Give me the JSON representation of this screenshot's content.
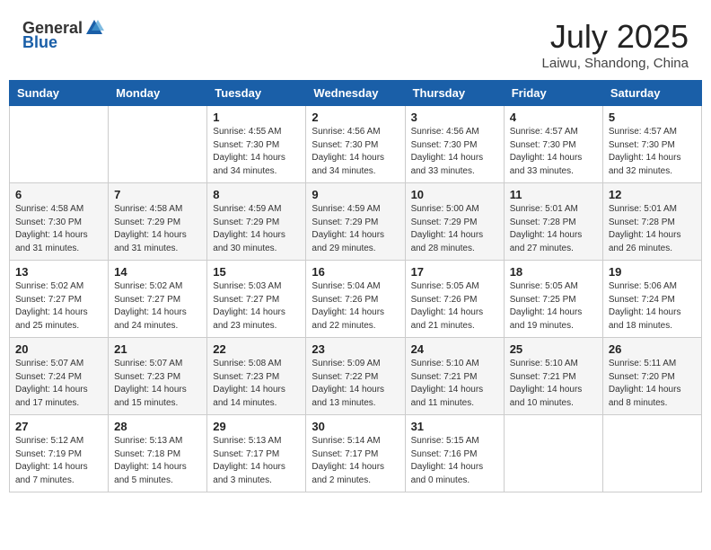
{
  "logo": {
    "general": "General",
    "blue": "Blue"
  },
  "title": "July 2025",
  "subtitle": "Laiwu, Shandong, China",
  "weekdays": [
    "Sunday",
    "Monday",
    "Tuesday",
    "Wednesday",
    "Thursday",
    "Friday",
    "Saturday"
  ],
  "weeks": [
    [
      {
        "day": "",
        "sunrise": "",
        "sunset": "",
        "daylight": ""
      },
      {
        "day": "",
        "sunrise": "",
        "sunset": "",
        "daylight": ""
      },
      {
        "day": "1",
        "sunrise": "Sunrise: 4:55 AM",
        "sunset": "Sunset: 7:30 PM",
        "daylight": "Daylight: 14 hours and 34 minutes."
      },
      {
        "day": "2",
        "sunrise": "Sunrise: 4:56 AM",
        "sunset": "Sunset: 7:30 PM",
        "daylight": "Daylight: 14 hours and 34 minutes."
      },
      {
        "day": "3",
        "sunrise": "Sunrise: 4:56 AM",
        "sunset": "Sunset: 7:30 PM",
        "daylight": "Daylight: 14 hours and 33 minutes."
      },
      {
        "day": "4",
        "sunrise": "Sunrise: 4:57 AM",
        "sunset": "Sunset: 7:30 PM",
        "daylight": "Daylight: 14 hours and 33 minutes."
      },
      {
        "day": "5",
        "sunrise": "Sunrise: 4:57 AM",
        "sunset": "Sunset: 7:30 PM",
        "daylight": "Daylight: 14 hours and 32 minutes."
      }
    ],
    [
      {
        "day": "6",
        "sunrise": "Sunrise: 4:58 AM",
        "sunset": "Sunset: 7:30 PM",
        "daylight": "Daylight: 14 hours and 31 minutes."
      },
      {
        "day": "7",
        "sunrise": "Sunrise: 4:58 AM",
        "sunset": "Sunset: 7:29 PM",
        "daylight": "Daylight: 14 hours and 31 minutes."
      },
      {
        "day": "8",
        "sunrise": "Sunrise: 4:59 AM",
        "sunset": "Sunset: 7:29 PM",
        "daylight": "Daylight: 14 hours and 30 minutes."
      },
      {
        "day": "9",
        "sunrise": "Sunrise: 4:59 AM",
        "sunset": "Sunset: 7:29 PM",
        "daylight": "Daylight: 14 hours and 29 minutes."
      },
      {
        "day": "10",
        "sunrise": "Sunrise: 5:00 AM",
        "sunset": "Sunset: 7:29 PM",
        "daylight": "Daylight: 14 hours and 28 minutes."
      },
      {
        "day": "11",
        "sunrise": "Sunrise: 5:01 AM",
        "sunset": "Sunset: 7:28 PM",
        "daylight": "Daylight: 14 hours and 27 minutes."
      },
      {
        "day": "12",
        "sunrise": "Sunrise: 5:01 AM",
        "sunset": "Sunset: 7:28 PM",
        "daylight": "Daylight: 14 hours and 26 minutes."
      }
    ],
    [
      {
        "day": "13",
        "sunrise": "Sunrise: 5:02 AM",
        "sunset": "Sunset: 7:27 PM",
        "daylight": "Daylight: 14 hours and 25 minutes."
      },
      {
        "day": "14",
        "sunrise": "Sunrise: 5:02 AM",
        "sunset": "Sunset: 7:27 PM",
        "daylight": "Daylight: 14 hours and 24 minutes."
      },
      {
        "day": "15",
        "sunrise": "Sunrise: 5:03 AM",
        "sunset": "Sunset: 7:27 PM",
        "daylight": "Daylight: 14 hours and 23 minutes."
      },
      {
        "day": "16",
        "sunrise": "Sunrise: 5:04 AM",
        "sunset": "Sunset: 7:26 PM",
        "daylight": "Daylight: 14 hours and 22 minutes."
      },
      {
        "day": "17",
        "sunrise": "Sunrise: 5:05 AM",
        "sunset": "Sunset: 7:26 PM",
        "daylight": "Daylight: 14 hours and 21 minutes."
      },
      {
        "day": "18",
        "sunrise": "Sunrise: 5:05 AM",
        "sunset": "Sunset: 7:25 PM",
        "daylight": "Daylight: 14 hours and 19 minutes."
      },
      {
        "day": "19",
        "sunrise": "Sunrise: 5:06 AM",
        "sunset": "Sunset: 7:24 PM",
        "daylight": "Daylight: 14 hours and 18 minutes."
      }
    ],
    [
      {
        "day": "20",
        "sunrise": "Sunrise: 5:07 AM",
        "sunset": "Sunset: 7:24 PM",
        "daylight": "Daylight: 14 hours and 17 minutes."
      },
      {
        "day": "21",
        "sunrise": "Sunrise: 5:07 AM",
        "sunset": "Sunset: 7:23 PM",
        "daylight": "Daylight: 14 hours and 15 minutes."
      },
      {
        "day": "22",
        "sunrise": "Sunrise: 5:08 AM",
        "sunset": "Sunset: 7:23 PM",
        "daylight": "Daylight: 14 hours and 14 minutes."
      },
      {
        "day": "23",
        "sunrise": "Sunrise: 5:09 AM",
        "sunset": "Sunset: 7:22 PM",
        "daylight": "Daylight: 14 hours and 13 minutes."
      },
      {
        "day": "24",
        "sunrise": "Sunrise: 5:10 AM",
        "sunset": "Sunset: 7:21 PM",
        "daylight": "Daylight: 14 hours and 11 minutes."
      },
      {
        "day": "25",
        "sunrise": "Sunrise: 5:10 AM",
        "sunset": "Sunset: 7:21 PM",
        "daylight": "Daylight: 14 hours and 10 minutes."
      },
      {
        "day": "26",
        "sunrise": "Sunrise: 5:11 AM",
        "sunset": "Sunset: 7:20 PM",
        "daylight": "Daylight: 14 hours and 8 minutes."
      }
    ],
    [
      {
        "day": "27",
        "sunrise": "Sunrise: 5:12 AM",
        "sunset": "Sunset: 7:19 PM",
        "daylight": "Daylight: 14 hours and 7 minutes."
      },
      {
        "day": "28",
        "sunrise": "Sunrise: 5:13 AM",
        "sunset": "Sunset: 7:18 PM",
        "daylight": "Daylight: 14 hours and 5 minutes."
      },
      {
        "day": "29",
        "sunrise": "Sunrise: 5:13 AM",
        "sunset": "Sunset: 7:17 PM",
        "daylight": "Daylight: 14 hours and 3 minutes."
      },
      {
        "day": "30",
        "sunrise": "Sunrise: 5:14 AM",
        "sunset": "Sunset: 7:17 PM",
        "daylight": "Daylight: 14 hours and 2 minutes."
      },
      {
        "day": "31",
        "sunrise": "Sunrise: 5:15 AM",
        "sunset": "Sunset: 7:16 PM",
        "daylight": "Daylight: 14 hours and 0 minutes."
      },
      {
        "day": "",
        "sunrise": "",
        "sunset": "",
        "daylight": ""
      },
      {
        "day": "",
        "sunrise": "",
        "sunset": "",
        "daylight": ""
      }
    ]
  ]
}
